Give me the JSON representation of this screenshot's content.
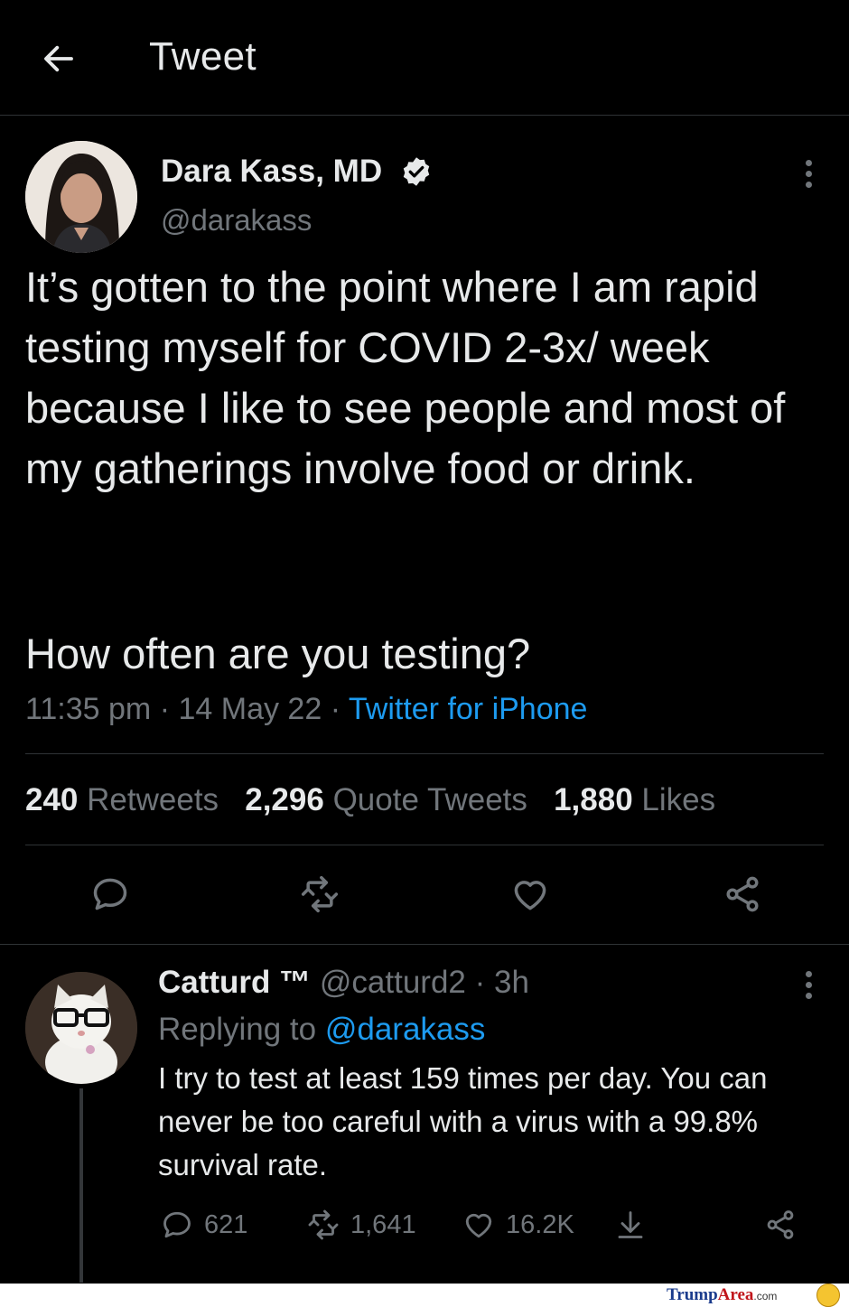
{
  "header": {
    "title": "Tweet"
  },
  "tweet": {
    "author_name": "Dara Kass, MD",
    "author_handle": "@darakass",
    "text_p1": "It’s gotten to the point where I am rapid testing myself for COVID 2-3x/ week because I like to see people and most of my gatherings involve food or drink.",
    "text_p2": "How often are you testing?",
    "time": "11:35 pm",
    "date": "14 May 22",
    "source": "Twitter for iPhone",
    "separator": "·",
    "stats": {
      "retweets_count": "240",
      "retweets_label": "Retweets",
      "quotes_count": "2,296",
      "quotes_label": "Quote Tweets",
      "likes_count": "1,880",
      "likes_label": "Likes"
    }
  },
  "reply": {
    "author_name": "Catturd ™",
    "author_handle": "@catturd2",
    "age": "3h",
    "replying_prefix": "Replying to",
    "replying_to": "@darakass",
    "text": "I try to test at least 159 times per day. You can never be too careful with a virus with a 99.8% survival rate.",
    "replies": "621",
    "retweets": "1,641",
    "likes": "16.2K"
  },
  "watermark": {
    "brand_a": "Trump",
    "brand_b": "Area",
    "suffix": ".com"
  },
  "colors": {
    "background": "#000000",
    "text": "#e7e9ea",
    "muted": "#71767b",
    "accent": "#1d9bf0",
    "divider": "#2f3336"
  },
  "icons": [
    "back-arrow-icon",
    "verified-badge-icon",
    "more-icon",
    "reply-icon",
    "retweet-icon",
    "like-icon",
    "share-icon",
    "download-icon"
  ]
}
